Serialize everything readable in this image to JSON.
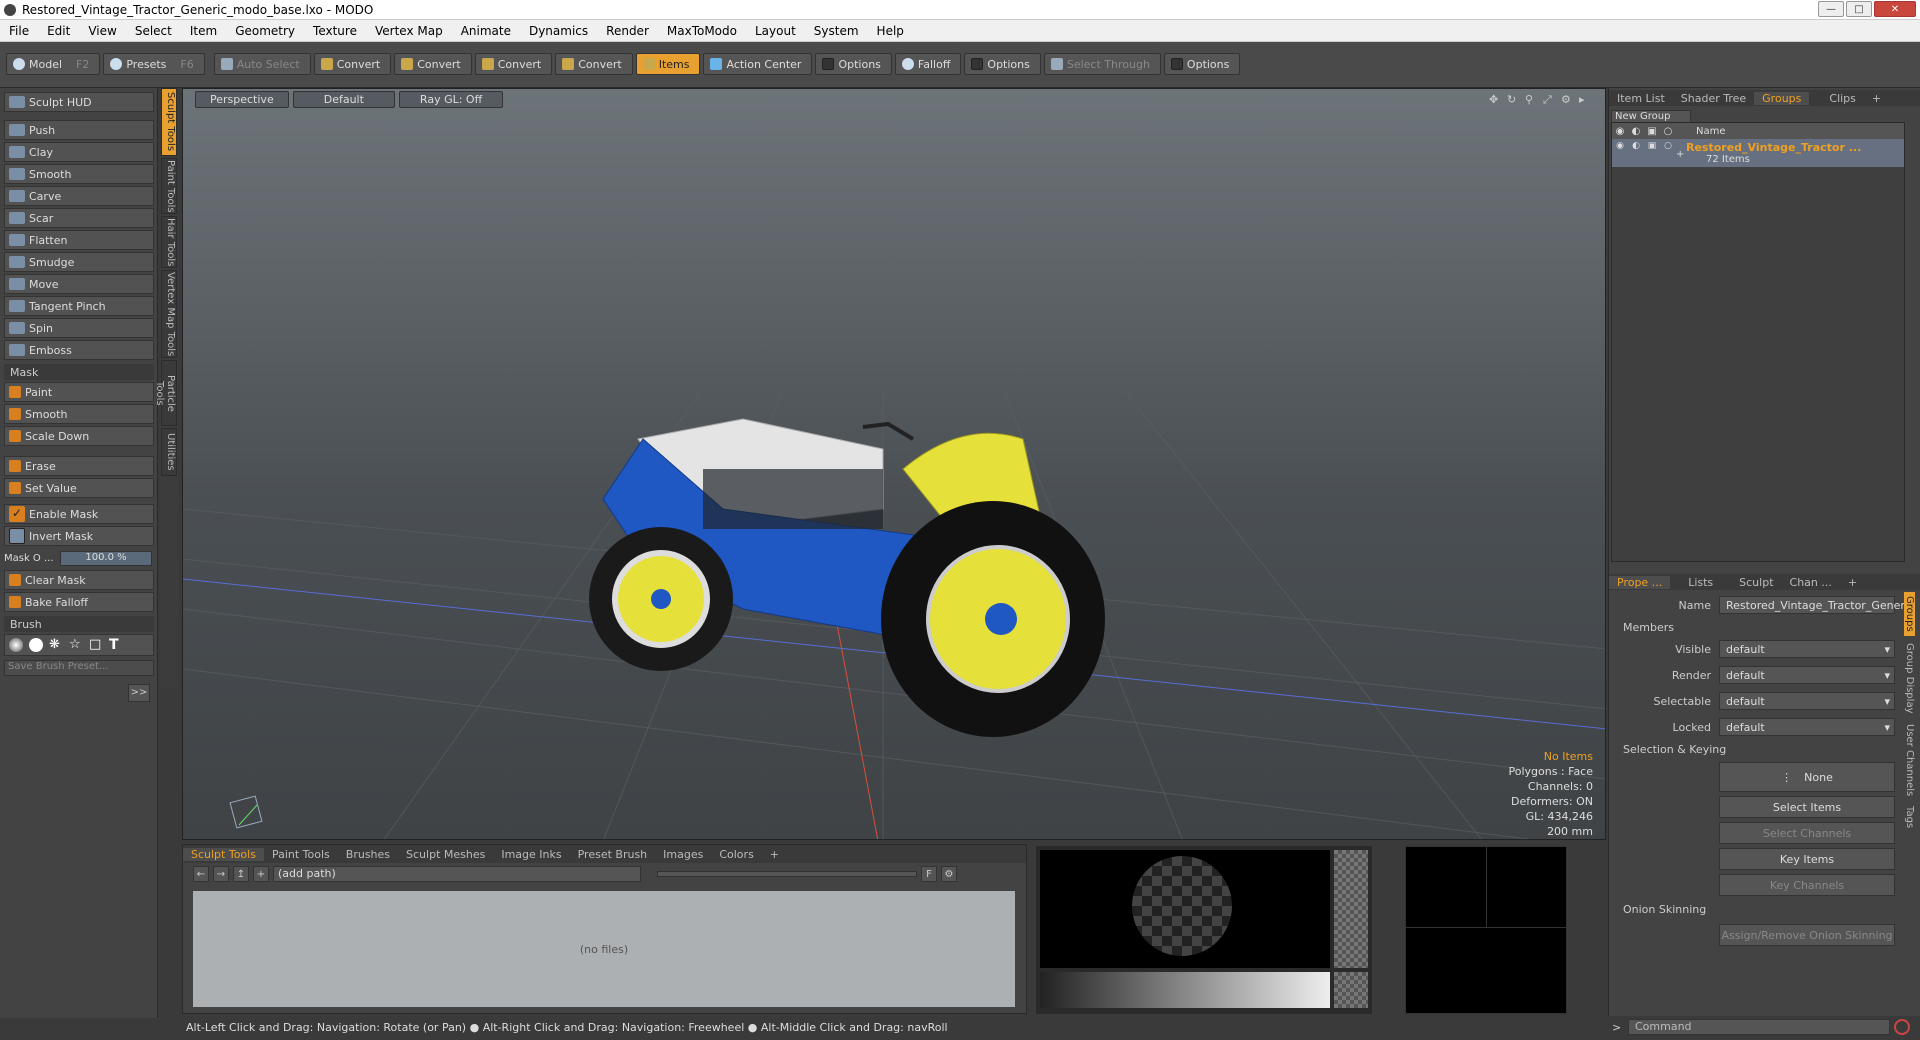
{
  "window": {
    "title": "Restored_Vintage_Tractor_Generic_modo_base.lxo - MODO"
  },
  "menu": [
    "File",
    "Edit",
    "View",
    "Select",
    "Item",
    "Geometry",
    "Texture",
    "Vertex Map",
    "Animate",
    "Dynamics",
    "Render",
    "MaxToModo",
    "Layout",
    "System",
    "Help"
  ],
  "toolbar": {
    "model": "Model",
    "model_key": "F2",
    "presets": "Presets",
    "presets_key": "F6",
    "auto_select": "Auto Select",
    "convert": "Convert",
    "items": "Items",
    "action_center": "Action Center",
    "options": "Options",
    "falloff": "Falloff",
    "select_through": "Select Through"
  },
  "left": {
    "hud": "Sculpt HUD",
    "tools": [
      "Push",
      "Clay",
      "Smooth",
      "Carve",
      "Scar",
      "Flatten",
      "Smudge",
      "Move",
      "Tangent Pinch",
      "Spin",
      "Emboss"
    ],
    "mask_header": "Mask",
    "mask_tools": [
      "Paint",
      "Smooth",
      "Scale Down"
    ],
    "erase": "Erase",
    "set_value": "Set Value",
    "enable_mask": "Enable Mask",
    "invert_mask": "Invert Mask",
    "mask_opacity_label": "Mask O ...",
    "mask_opacity_value": "100.0 %",
    "clear_mask": "Clear Mask",
    "bake_falloff": "Bake Falloff",
    "brush_header": "Brush",
    "save_brush": "Save Brush Preset...",
    "expand": ">>"
  },
  "vtabs": [
    "Sculpt Tools",
    "Paint Tools",
    "Hair Tools",
    "Vertex Map Tools",
    "Particle Tools",
    "Utilities"
  ],
  "viewport": {
    "view": "Perspective",
    "shading": "Default",
    "raygl": "Ray GL: Off",
    "info": {
      "items": "No Items",
      "polygons": "Polygons : Face",
      "channels": "Channels: 0",
      "deformers": "Deformers: ON",
      "gl": "GL: 434,246",
      "scale": "200 mm"
    }
  },
  "bottom": {
    "tabs": [
      "Sculpt Tools",
      "Paint Tools",
      "Brushes",
      "Sculpt Meshes",
      "Image Inks",
      "Preset Brush",
      "Images",
      "Colors",
      "+"
    ],
    "path": "(add path)",
    "files": "(no files)"
  },
  "status": "Alt-Left Click and Drag: Navigation: Rotate (or Pan) ● Alt-Right Click and Drag: Navigation: Freewheel ● Alt-Middle Click and Drag: navRoll",
  "right": {
    "tabs": [
      "Item List",
      "Shader Tree",
      "Groups",
      "Clips",
      "+"
    ],
    "new_group": "New Group",
    "name_col": "Name",
    "group_name": "Restored_Vintage_Tractor ...",
    "group_count": "72 Items",
    "prop_tabs": [
      "Prope ...",
      "Lists",
      "Sculpt",
      "Chan ...",
      "+"
    ],
    "name_label": "Name",
    "name_value": "Restored_Vintage_Tractor_Generi",
    "members": "Members",
    "visible": "Visible",
    "render": "Render",
    "selectable": "Selectable",
    "locked": "Locked",
    "default": "default",
    "selection_keying": "Selection & Keying",
    "none": "None",
    "select_items": "Select Items",
    "select_channels": "Select Channels",
    "key_items": "Key Items",
    "key_channels": "Key Channels",
    "onion": "Onion Skinning",
    "onion_btn": "Assign/Remove Onion Skinning",
    "side_tabs": [
      "Groups",
      "Group Display",
      "User Channels",
      "Tags"
    ],
    "command": "Command"
  },
  "colors": {
    "accent": "#e8a030",
    "tractor_blue": "#1f57c3",
    "tractor_yellow": "#e6e03a"
  }
}
